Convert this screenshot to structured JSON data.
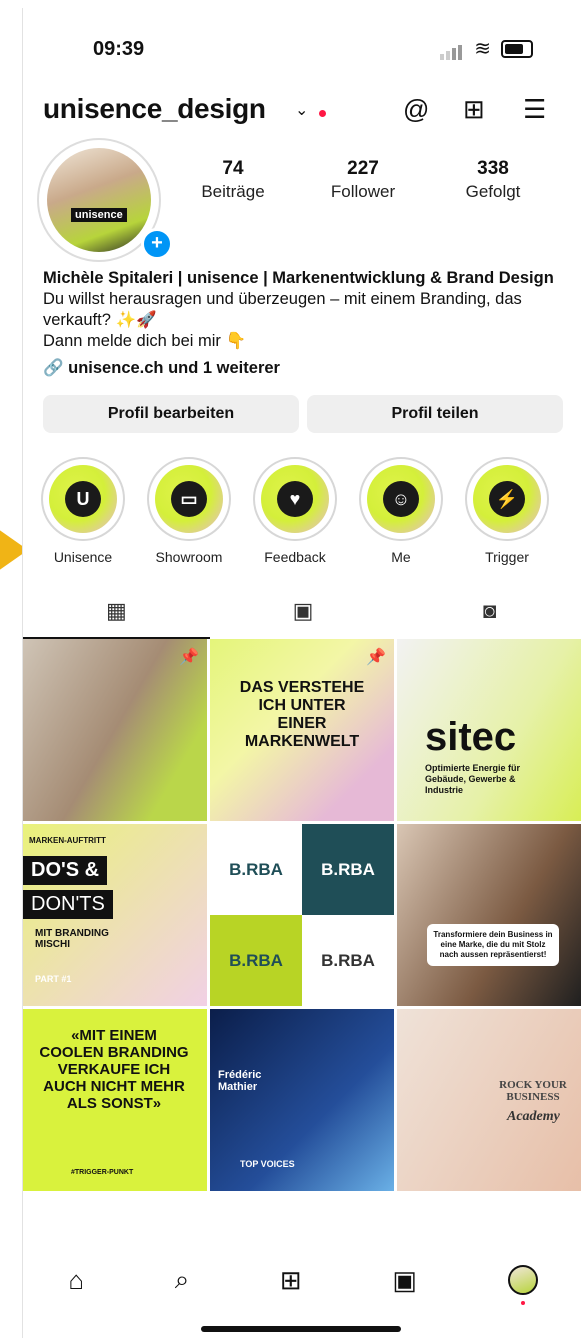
{
  "status": {
    "time": "09:39"
  },
  "header": {
    "username": "unisence_design",
    "chevron": "⌄"
  },
  "profile": {
    "avatar_label": "unisence",
    "stats": [
      {
        "num": "74",
        "label": "Beiträge"
      },
      {
        "num": "227",
        "label": "Follower"
      },
      {
        "num": "338",
        "label": "Gefolgt"
      }
    ]
  },
  "bio": {
    "name": "Michèle Spitaleri | unisence | Markenentwicklung & Brand Design",
    "line1": "Du willst herausragen und überzeugen – mit einem Branding, das verkauft? ✨🚀",
    "line2": "Dann melde dich bei mir 👇",
    "link": "unisence.ch und 1 weiterer"
  },
  "buttons": {
    "edit": "Profil bearbeiten",
    "share": "Profil teilen"
  },
  "highlights": [
    {
      "label": "Unisence",
      "glyph": "U",
      "icon": "u-icon"
    },
    {
      "label": "Showroom",
      "glyph": "▭",
      "icon": "monitor-icon"
    },
    {
      "label": "Feedback",
      "glyph": "♥",
      "icon": "heart-icon"
    },
    {
      "label": "Me",
      "glyph": "☺",
      "icon": "smile-icon"
    },
    {
      "label": "Trigger",
      "glyph": "⚡",
      "icon": "bolt-icon"
    }
  ],
  "posts": {
    "p2": {
      "text": "DAS VERSTEHE ICH UNTER EINER MARKENWELT"
    },
    "p3": {
      "title": "sitec",
      "sub": "Optimierte Energie für Gebäude, Gewerbe & Industrie"
    },
    "p4": {
      "top": "MARKEN-AUFTRITT",
      "a": "DO'S &",
      "b": "DON'TS",
      "c": "MIT BRANDING MISCHI",
      "d": "PART #1"
    },
    "p5": {
      "logo": "B.RBA"
    },
    "p6": {
      "text": "Transformiere dein Business in eine Marke, die du mit Stolz nach aussen repräsentierst!"
    },
    "p7": {
      "text": "«MIT EINEM COOLEN BRANDING VERKAUFE ICH AUCH NICHT MEHR ALS SONST»",
      "tag": "#TRIGGER-PUNKT"
    },
    "p8": {
      "name": "Frédéric Mathier",
      "tag": "TOP VOICES"
    },
    "p9": {
      "text": "ROCK YOUR BUSINESS",
      "script": "Academy"
    }
  },
  "colors": {
    "accent": "#0095f6",
    "lime": "#d9f23d",
    "notify": "#ff1744",
    "arrow": "#f0b416"
  }
}
